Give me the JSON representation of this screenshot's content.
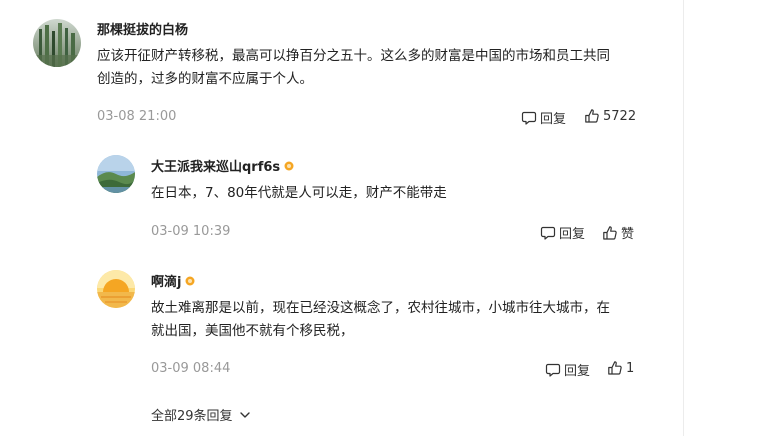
{
  "comments": [
    {
      "author": "那棵挺拔的白杨",
      "text_line1": "应该开征财产转移税，最高可以挣百分之五十。这么多的财富是中国的市场和员工共同",
      "text_line2": "创造的，过多的财富不应属于个人。",
      "time": "03-08 21:00",
      "reply_label": "回复",
      "like_label": "5722",
      "avatar_icon": "forest-avatar-icon"
    }
  ],
  "replies": [
    {
      "author": "大王派我来巡山qrf6s",
      "has_badge": true,
      "text_line1": "在日本，7、80年代就是人可以走，财产不能带走",
      "time": "03-09 10:39",
      "reply_label": "回复",
      "like_label": "赞",
      "avatar_icon": "landscape-avatar-icon"
    },
    {
      "author": "啊滴j",
      "has_badge": true,
      "text_line1": "故土难离那是以前，现在已经没这概念了，农村往城市，小城市往大城市，在",
      "text_line2": "就出国，美国他不就有个移民税，",
      "time": "03-09 08:44",
      "reply_label": "回复",
      "like_label": "1",
      "avatar_icon": "sunset-avatar-icon"
    }
  ],
  "more_replies": {
    "label": "全部29条回复"
  },
  "colors": {
    "time_gray": "#999999",
    "badge_orange": "#f5a623",
    "divider": "#ececec"
  }
}
